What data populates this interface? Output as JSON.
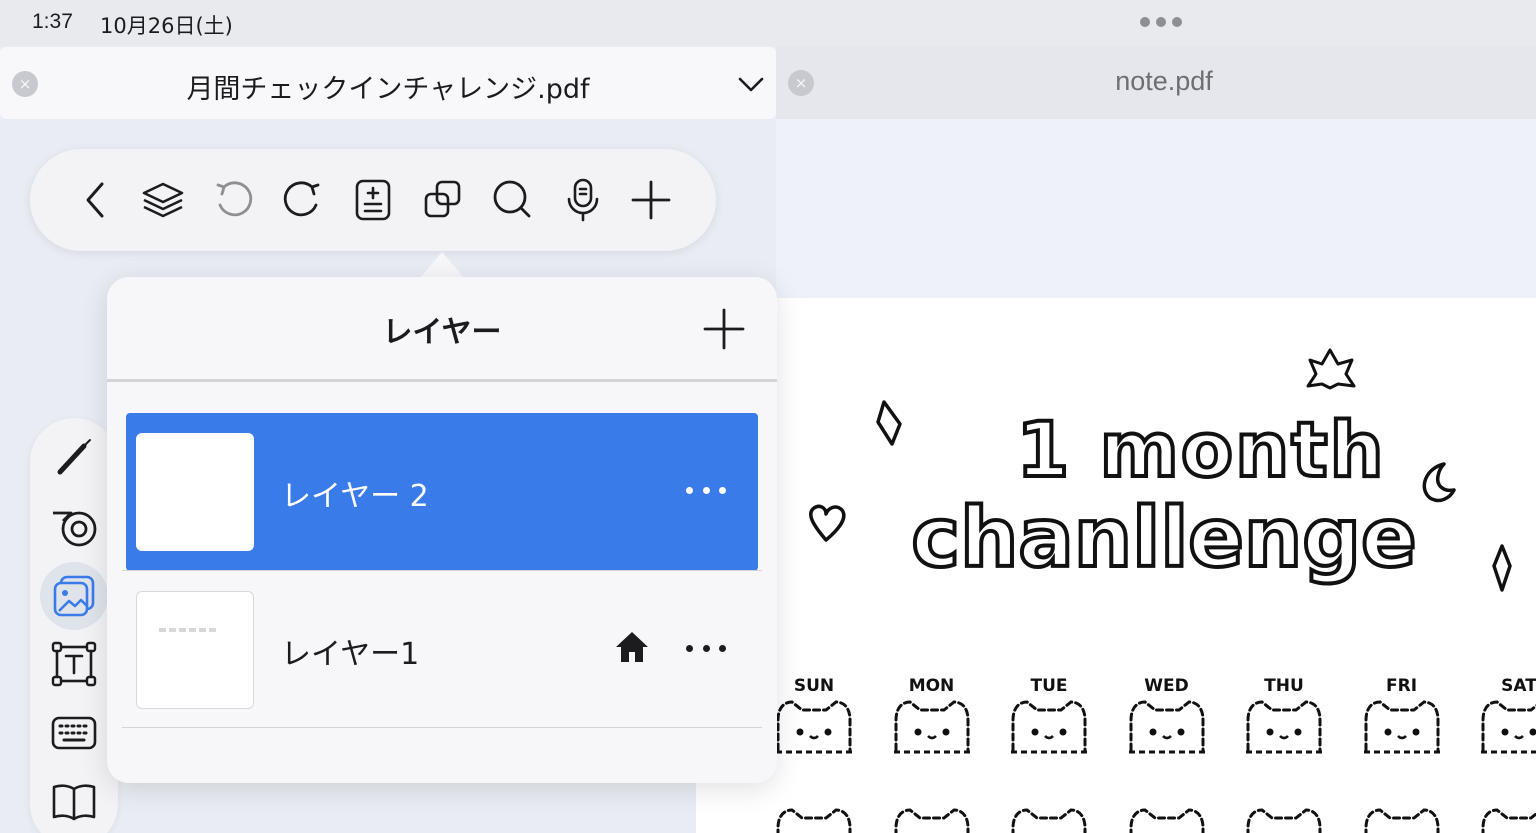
{
  "status_bar": {
    "time": "1:37",
    "date": "10月26日(土)"
  },
  "tabs": [
    {
      "title": "月間チェックインチャレンジ.pdf",
      "active": true,
      "close_symbol": "×"
    },
    {
      "title": "note.pdf",
      "active": false,
      "close_symbol": "×"
    }
  ],
  "toolbar": {
    "icons": [
      "back-chevron-icon",
      "layers-icon",
      "undo-icon",
      "redo-icon",
      "page-add-icon",
      "duplicate-icon",
      "search-icon",
      "microphone-icon",
      "plus-icon"
    ]
  },
  "side_tools": {
    "icons": [
      "pen-icon",
      "tape-icon",
      "image-icon",
      "text-box-icon",
      "keyboard-icon",
      "book-icon"
    ],
    "active": "image-icon"
  },
  "layers_popover": {
    "title": "レイヤー",
    "layers": [
      {
        "name": "レイヤー 2",
        "selected": true,
        "home": false
      },
      {
        "name": "レイヤー1",
        "selected": false,
        "home": true
      }
    ]
  },
  "colors": {
    "accent": "#3a7bea",
    "background": "#e9ecf3",
    "panel": "#f7f7f9"
  },
  "document": {
    "title_art": [
      "1 month",
      "chanllenge"
    ],
    "days": [
      "SUN",
      "MON",
      "TUE",
      "WED",
      "THU",
      "FRI",
      "SAT"
    ]
  }
}
